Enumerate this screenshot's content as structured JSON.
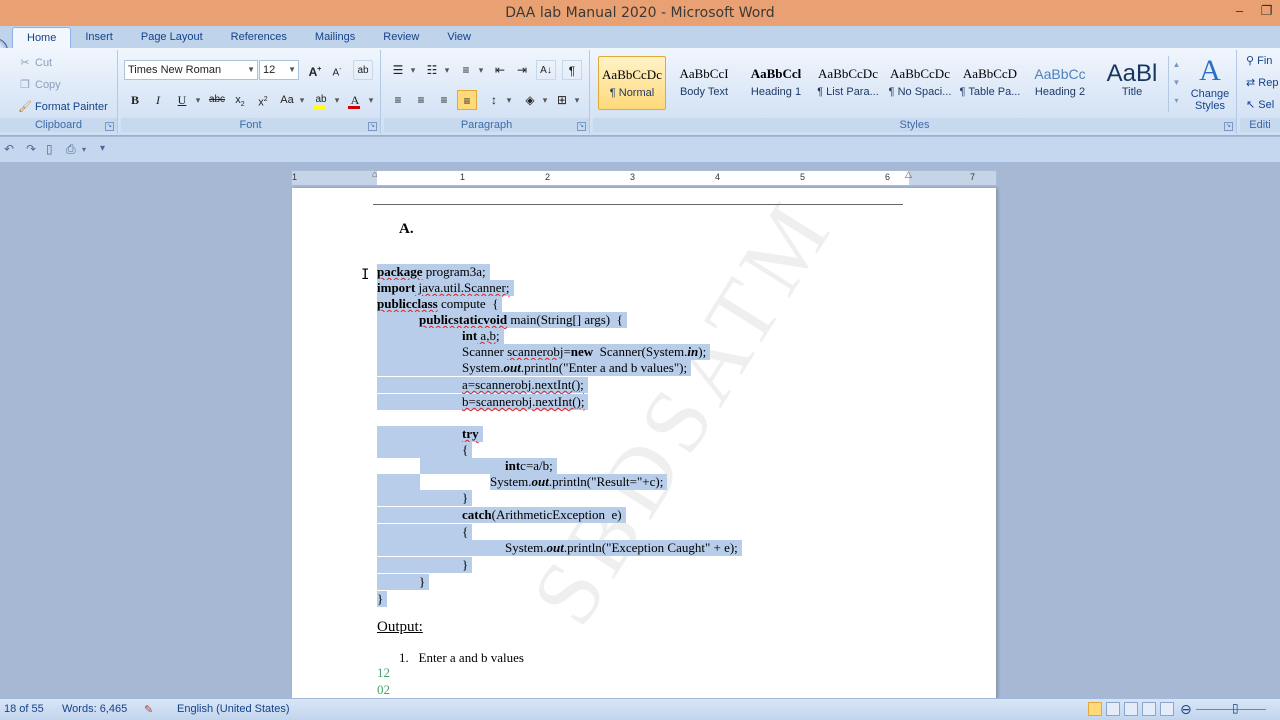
{
  "window": {
    "title": "DAA lab Manual 2020 - Microsoft Word",
    "controls": [
      "–",
      "❐"
    ]
  },
  "tabs": [
    "Home",
    "Insert",
    "Page Layout",
    "References",
    "Mailings",
    "Review",
    "View"
  ],
  "clipboard": {
    "cut": "Cut",
    "copy": "Copy",
    "format_painter": "Format Painter",
    "label": "Clipboard"
  },
  "font": {
    "name": "Times New Roman",
    "size": "12",
    "label": "Font",
    "highlight_color": "#ffff00",
    "font_color": "#d00000"
  },
  "paragraph": {
    "label": "Paragraph"
  },
  "styles": {
    "label": "Styles",
    "items": [
      {
        "sample": "AaBbCcDc",
        "name": "¶ Normal"
      },
      {
        "sample": "AaBbCcI",
        "name": "Body Text"
      },
      {
        "sample": "AaBbCcl",
        "name": "Heading 1"
      },
      {
        "sample": "AaBbCcDc",
        "name": "¶ List Para..."
      },
      {
        "sample": "AaBbCcDc",
        "name": "¶ No Spaci..."
      },
      {
        "sample": "AaBbCcD",
        "name": "¶ Table Pa..."
      },
      {
        "sample": "AaBbCc",
        "name": "Heading 2"
      },
      {
        "sample": "AaBl",
        "name": "Title"
      }
    ],
    "change_styles_1": "Change",
    "change_styles_2": "Styles"
  },
  "editing": {
    "find": "Fin",
    "replace": "Rep",
    "select": "Sel",
    "label": "Editi"
  },
  "ruler": [
    "1",
    "1",
    "2",
    "3",
    "4",
    "5",
    "6",
    "7"
  ],
  "document": {
    "heading": "A.",
    "code": {
      "l1_kw": "package",
      "l1_rest": " program3a;",
      "l2_kw": "import",
      "l2_rest": " java.util.Scanner;",
      "l3_kw": "publicclass",
      "l3_rest": " compute  {",
      "l4_kw": "publicstaticvoid",
      "l4_rest": " main(String[] args)  {",
      "l5_kw": "int",
      "l5_rest": " a,b;",
      "l6_a": "Scanner ",
      "l6_b": "scannerobj",
      "l6_c": "=",
      "l6_kw": "new",
      "l6_d": "  Scanner(System.",
      "l6_it": "in",
      "l6_e": ");",
      "l7_a": "System.",
      "l7_it": "out",
      "l7_b": ".println(\"Enter a and b values\");",
      "l8": "a=scannerobj.nextInt();",
      "l9": "b=scannerobj.nextInt();",
      "l10_kw": "try",
      "l11": "{",
      "l12_kw": "int",
      "l12_rest": "c=a/b;",
      "l13_a": "System.",
      "l13_it": "out",
      "l13_b": ".println(\"Result=\"+c);",
      "l14": "}",
      "l15_kw": "catch",
      "l15_rest": "(ArithmeticException  e)",
      "l16": "{",
      "l17_a": "System.",
      "l17_it": "out",
      "l17_b": ".println(\"Exception Caught\" + e);",
      "l18": "}",
      "l19": "}",
      "l20": "}"
    },
    "output_heading": "Output:",
    "list_item": "1.   Enter a and b values",
    "out1": "12",
    "out2": "02",
    "watermark": "SBDSATM"
  },
  "status": {
    "page": "18 of 55",
    "words": "Words: 6,465",
    "language": "English (United States)"
  }
}
